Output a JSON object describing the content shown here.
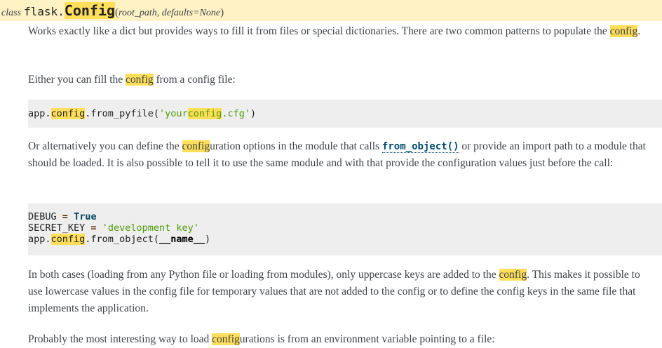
{
  "signature": {
    "keyword": "class",
    "module": "flask.",
    "name": "Config",
    "open_paren": "(",
    "params": "root_path, defaults=None",
    "close_paren": ")"
  },
  "para1": {
    "text_a": "Works exactly like a dict but provides ways to fill it from files or special dictionaries. There are two common patterns to populate the ",
    "hl": "config",
    "text_b": "."
  },
  "para2": {
    "text_a": "Either you can fill the ",
    "hl": "config",
    "text_b": " from a config file:"
  },
  "code1": {
    "a": "app.",
    "hl1": "config",
    "b": ".from_pyfile(",
    "str_a": "'your",
    "hl2": "config",
    "str_b": ".cfg'",
    "c": ")"
  },
  "para3": {
    "text_a": "Or alternatively you can define the ",
    "hl": "config",
    "text_b": "uration options in the module that calls ",
    "link": "from_object()",
    "text_c": " or provide an import path to a module that should be loaded. It is also possible to tell it to use the same module and with that provide the configuration values just before the call:"
  },
  "code2": {
    "l1_a": "DEBUG ",
    "l1_op": "=",
    "l1_sp": " ",
    "l1_kw": "True",
    "l2_a": "SECRET_KEY ",
    "l2_op": "=",
    "l2_sp": " ",
    "l2_str": "'development key'",
    "l3_a": "app.",
    "l3_hl": "config",
    "l3_b": ".from_object(",
    "l3_bi": "__name__",
    "l3_c": ")"
  },
  "para4": {
    "text_a": "In both cases (loading from any Python file or loading from modules), only uppercase keys are added to the ",
    "hl": "config",
    "text_b": ". This makes it possible to use lowercase values in the config file for temporary values that are not added to the config or to define the config keys in the same file that implements the application."
  },
  "para5": {
    "text_a": "Probably the most interesting way to load ",
    "hl": "config",
    "text_b": "urations is from an environment variable pointing to a file:"
  }
}
